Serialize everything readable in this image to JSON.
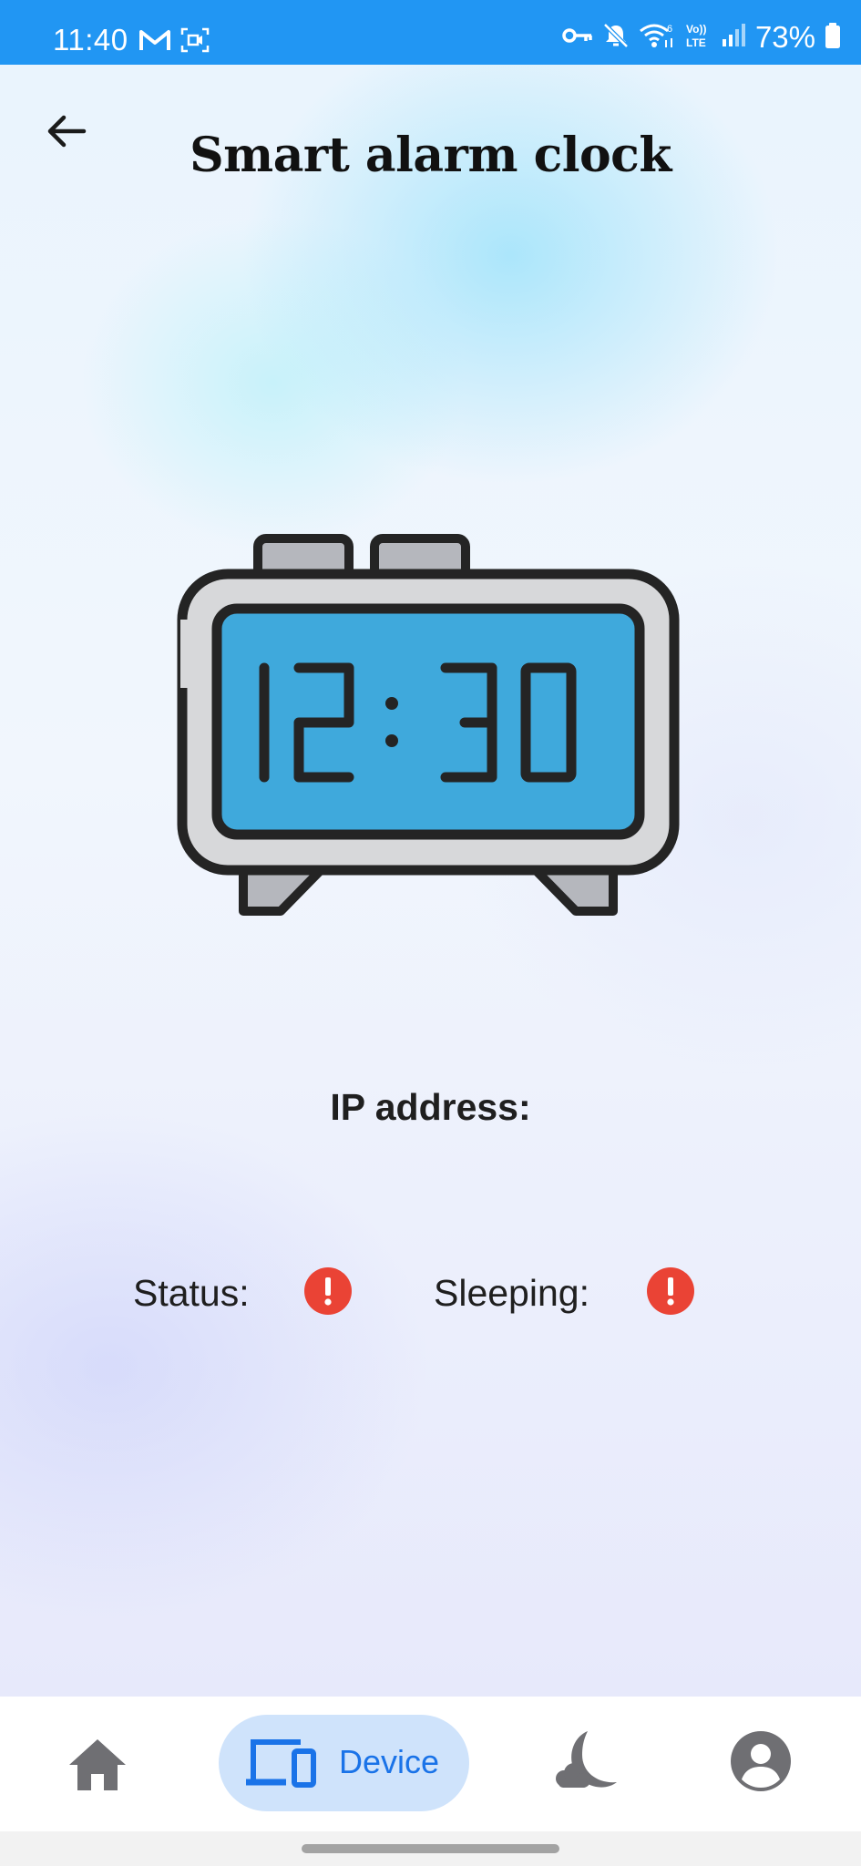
{
  "status_bar": {
    "time": "11:40",
    "battery_text": "73%",
    "icons": [
      "gmail-icon",
      "screen-record-icon",
      "vpn-key-icon",
      "mute-icon",
      "wifi-6-icon",
      "volte-icon",
      "signal-icon",
      "battery-icon"
    ],
    "background_color": "#2196f3"
  },
  "header": {
    "title": "Smart alarm clock",
    "back_icon": "arrow-left-icon"
  },
  "device": {
    "illustration": "alarm-clock-icon",
    "display_time": "12:30",
    "ip_label": "IP address:",
    "status_label": "Status:",
    "sleeping_label": "Sleeping:",
    "status_icon": "alert-icon",
    "sleeping_icon": "alert-icon",
    "alert_color": "#ea4335"
  },
  "bottom_nav": {
    "items": [
      {
        "icon": "home-icon",
        "label": "",
        "selected": false
      },
      {
        "icon": "devices-icon",
        "label": "Device",
        "selected": true
      },
      {
        "icon": "sleep-moon-icon",
        "label": "",
        "selected": false
      },
      {
        "icon": "account-icon",
        "label": "",
        "selected": false
      }
    ],
    "accent_color": "#1a73e8",
    "pill_color": "#cfe3fb"
  }
}
